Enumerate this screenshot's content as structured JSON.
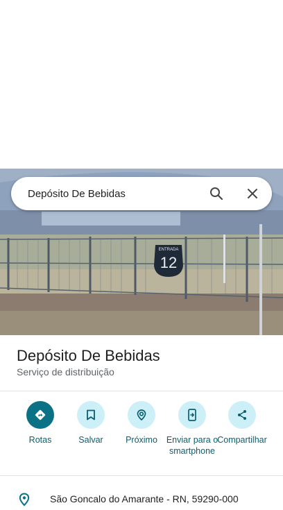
{
  "search": {
    "query": "Depósito De Bebidas"
  },
  "photo": {
    "sign_line1": "ENTRADA",
    "sign_number": "12"
  },
  "place": {
    "title": "Depósito De Bebidas",
    "category": "Serviço de distribuição"
  },
  "actions": [
    {
      "label": "Rotas",
      "icon": "directions-icon"
    },
    {
      "label": "Salvar",
      "icon": "bookmark-icon"
    },
    {
      "label": "Próximo",
      "icon": "nearby-icon"
    },
    {
      "label": "Enviar para o smartphone",
      "icon": "send-to-phone-icon"
    },
    {
      "label": "Compartilhar",
      "icon": "share-icon"
    }
  ],
  "address": {
    "text": "São Goncalo do Amarante - RN, 59290-000",
    "icon": "location-pin-icon"
  },
  "colors": {
    "accent": "#0b7285",
    "action_bg": "#cdeff8",
    "action_text": "#0b5e6e"
  }
}
